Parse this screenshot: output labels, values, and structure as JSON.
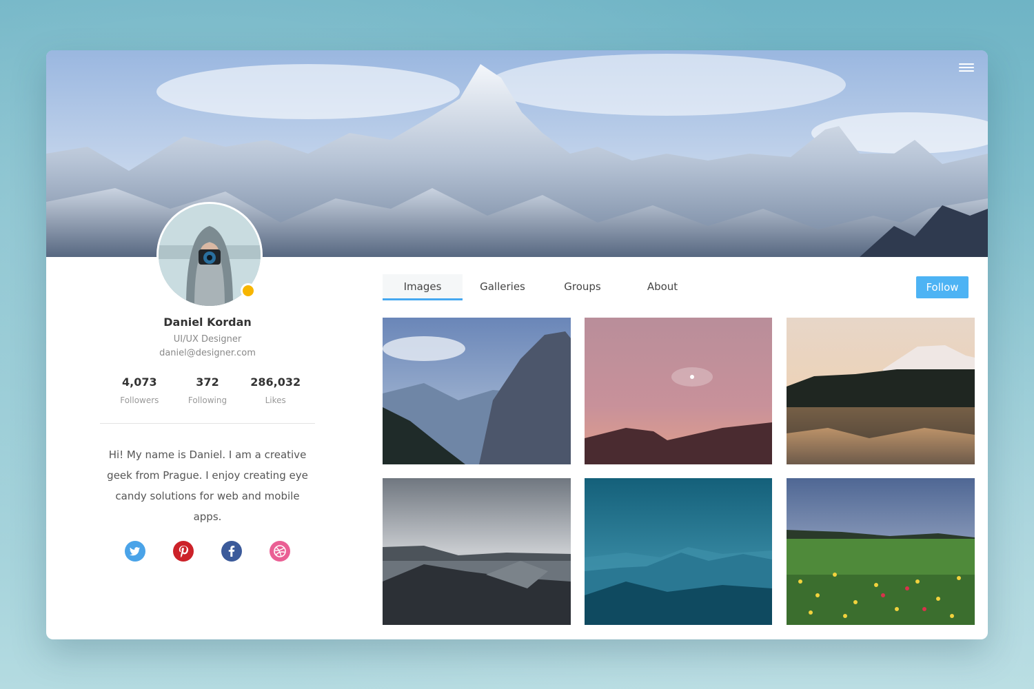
{
  "profile": {
    "name": "Daniel Kordan",
    "role": "UI/UX Designer",
    "email": "daniel@designer.com",
    "bio": "Hi! My name is Daniel. I am a creative geek from Prague. I enjoy creating eye candy solutions for web and mobile apps."
  },
  "stats": [
    {
      "value": "4,073",
      "label": "Followers"
    },
    {
      "value": "372",
      "label": "Following"
    },
    {
      "value": "286,032",
      "label": "Likes"
    }
  ],
  "tabs": [
    {
      "label": "Images",
      "active": true
    },
    {
      "label": "Galleries"
    },
    {
      "label": "Groups"
    },
    {
      "label": "About"
    }
  ],
  "follow_label": "Follow",
  "socials": [
    {
      "icon": "twitter-icon",
      "color": "#4aa3e8"
    },
    {
      "icon": "pinterest-icon",
      "color": "#cc2229"
    },
    {
      "icon": "facebook-icon",
      "color": "#3b5a9a"
    },
    {
      "icon": "dribbble-icon",
      "color": "#ea5f94"
    }
  ],
  "colors": {
    "accent": "#45a8f0",
    "status": "#f7b500"
  }
}
